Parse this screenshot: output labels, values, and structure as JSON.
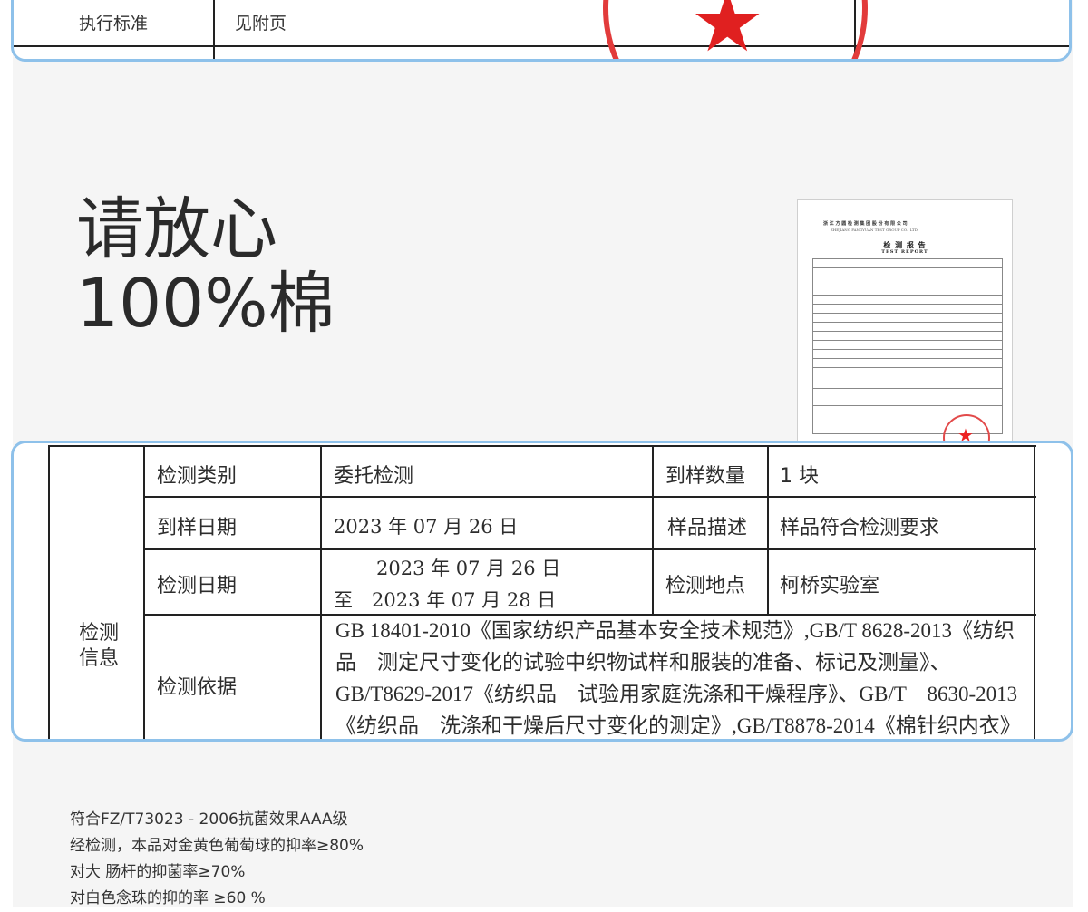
{
  "top_table": {
    "label": "执行标准",
    "value": "见附页"
  },
  "headline": {
    "line1": "请放心",
    "line2": "100%棉"
  },
  "report_thumb": {
    "title_cn": "检 测 报 告",
    "title_en": "TEST REPORT",
    "org_cn": "浙 江 方 圆 检 测 集 团 股 份 有 限 公 司",
    "org_en": "ZHEJIANG FANGYUAN TEST GROUP CO., LTD."
  },
  "main_table": {
    "section_label_1": "检测",
    "section_label_2": "信息",
    "rows": [
      {
        "label": "检测类别",
        "value": "委托检测",
        "label2": "到样数量",
        "value2": "1 块"
      },
      {
        "label": "到样日期",
        "value": "2023 年 07 月 26 日",
        "label2": "样品描述",
        "value2": "样品符合检测要求"
      },
      {
        "label": "检测日期",
        "value_line1": "2023 年 07 月 26 日",
        "value_line2": "至　2023 年 07 月 28 日",
        "label2": "检测地点",
        "value2": "柯桥实验室"
      },
      {
        "label": "检测依据"
      }
    ],
    "basis_lines": [
      "GB 18401-2010《国家纺织产品基本安全技术规范》,GB/T 8628-2013《纺织",
      "品　测定尺寸变化的试验中织物试样和服装的准备、标记及测量》、",
      "GB/T8629-2017《纺织品　试验用家庭洗涤和干燥程序》、GB/T　8630-2013",
      "《纺织品　洗涤和干燥后尺寸变化的测定》,GB/T8878-2014《棉针织内衣》"
    ]
  },
  "notes": [
    "符合FZ/T73023 - 2006抗菌效果AAA级",
    "经检测，本品对金黄色葡萄球的抑率≥80%",
    "对大 肠杆的抑菌率≥70%",
    "对白色念珠的抑的率 ≥60 %"
  ],
  "colors": {
    "frame_border": "#8ec1ea",
    "stamp_red": "#e23b3b",
    "page_bg": "#f5f5f5"
  }
}
